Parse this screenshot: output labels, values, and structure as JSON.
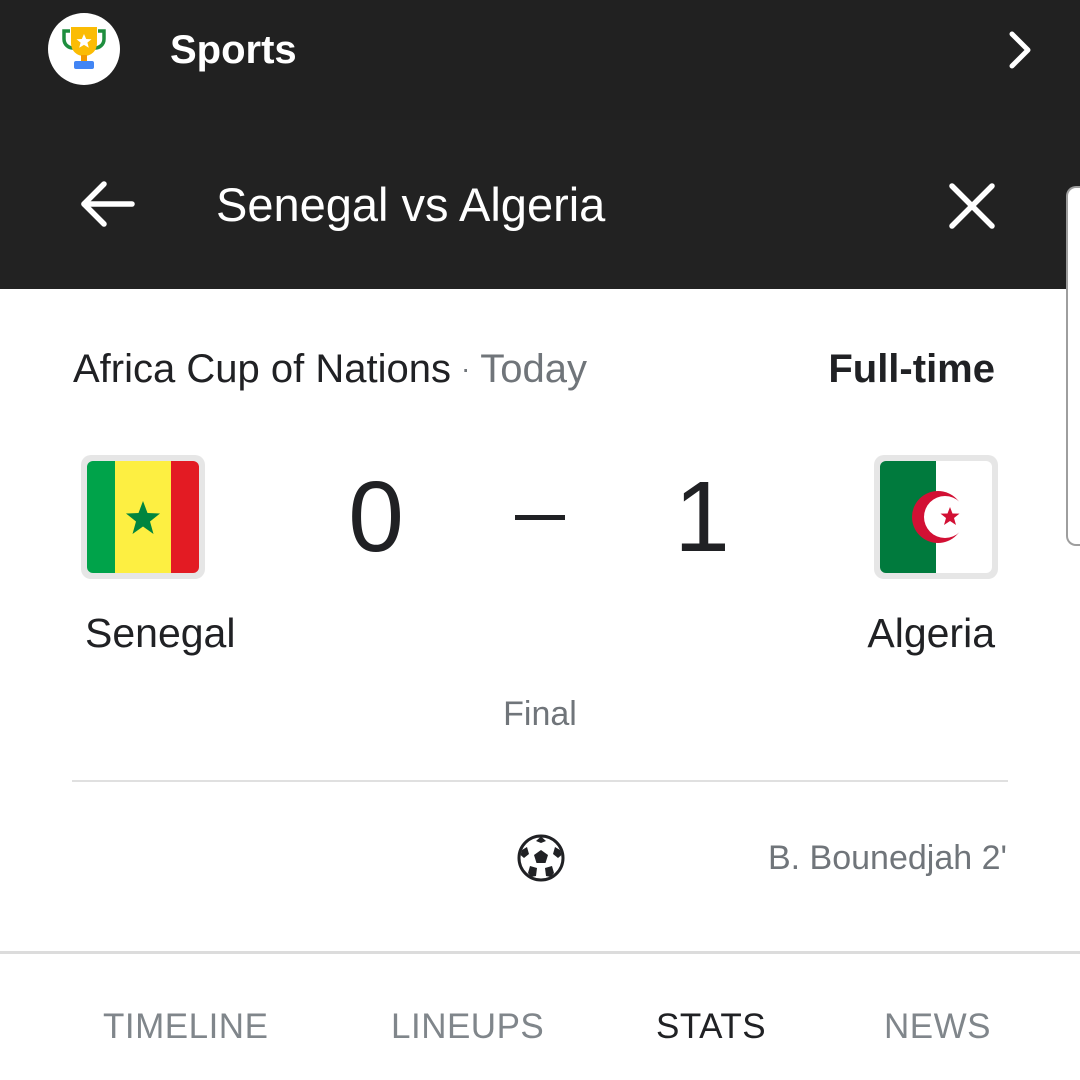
{
  "app": {
    "name": "Sports",
    "icon": "trophy-icon"
  },
  "header": {
    "title": "Senegal vs Algeria",
    "back_icon": "arrow-back-icon",
    "close_icon": "close-icon"
  },
  "match": {
    "competition": "Africa Cup of Nations",
    "separator": "·",
    "date": "Today",
    "status": "Full-time",
    "home": {
      "name": "Senegal",
      "score": "0",
      "flag_icon": "senegal-flag-icon"
    },
    "away": {
      "name": "Algeria",
      "score": "1",
      "flag_icon": "algeria-flag-icon"
    },
    "state": "Final",
    "goals": [
      {
        "icon": "soccer-ball-icon",
        "scorer": "B. Bounedjah 2'"
      }
    ]
  },
  "tabs": [
    {
      "label": "TIMELINE",
      "active": false
    },
    {
      "label": "LINEUPS",
      "active": false
    },
    {
      "label": "STATS",
      "active": true
    },
    {
      "label": "NEWS",
      "active": false
    }
  ],
  "colors": {
    "topbar": "#212121",
    "header": "#222222",
    "text_primary": "#202124",
    "text_secondary": "#70757a"
  }
}
